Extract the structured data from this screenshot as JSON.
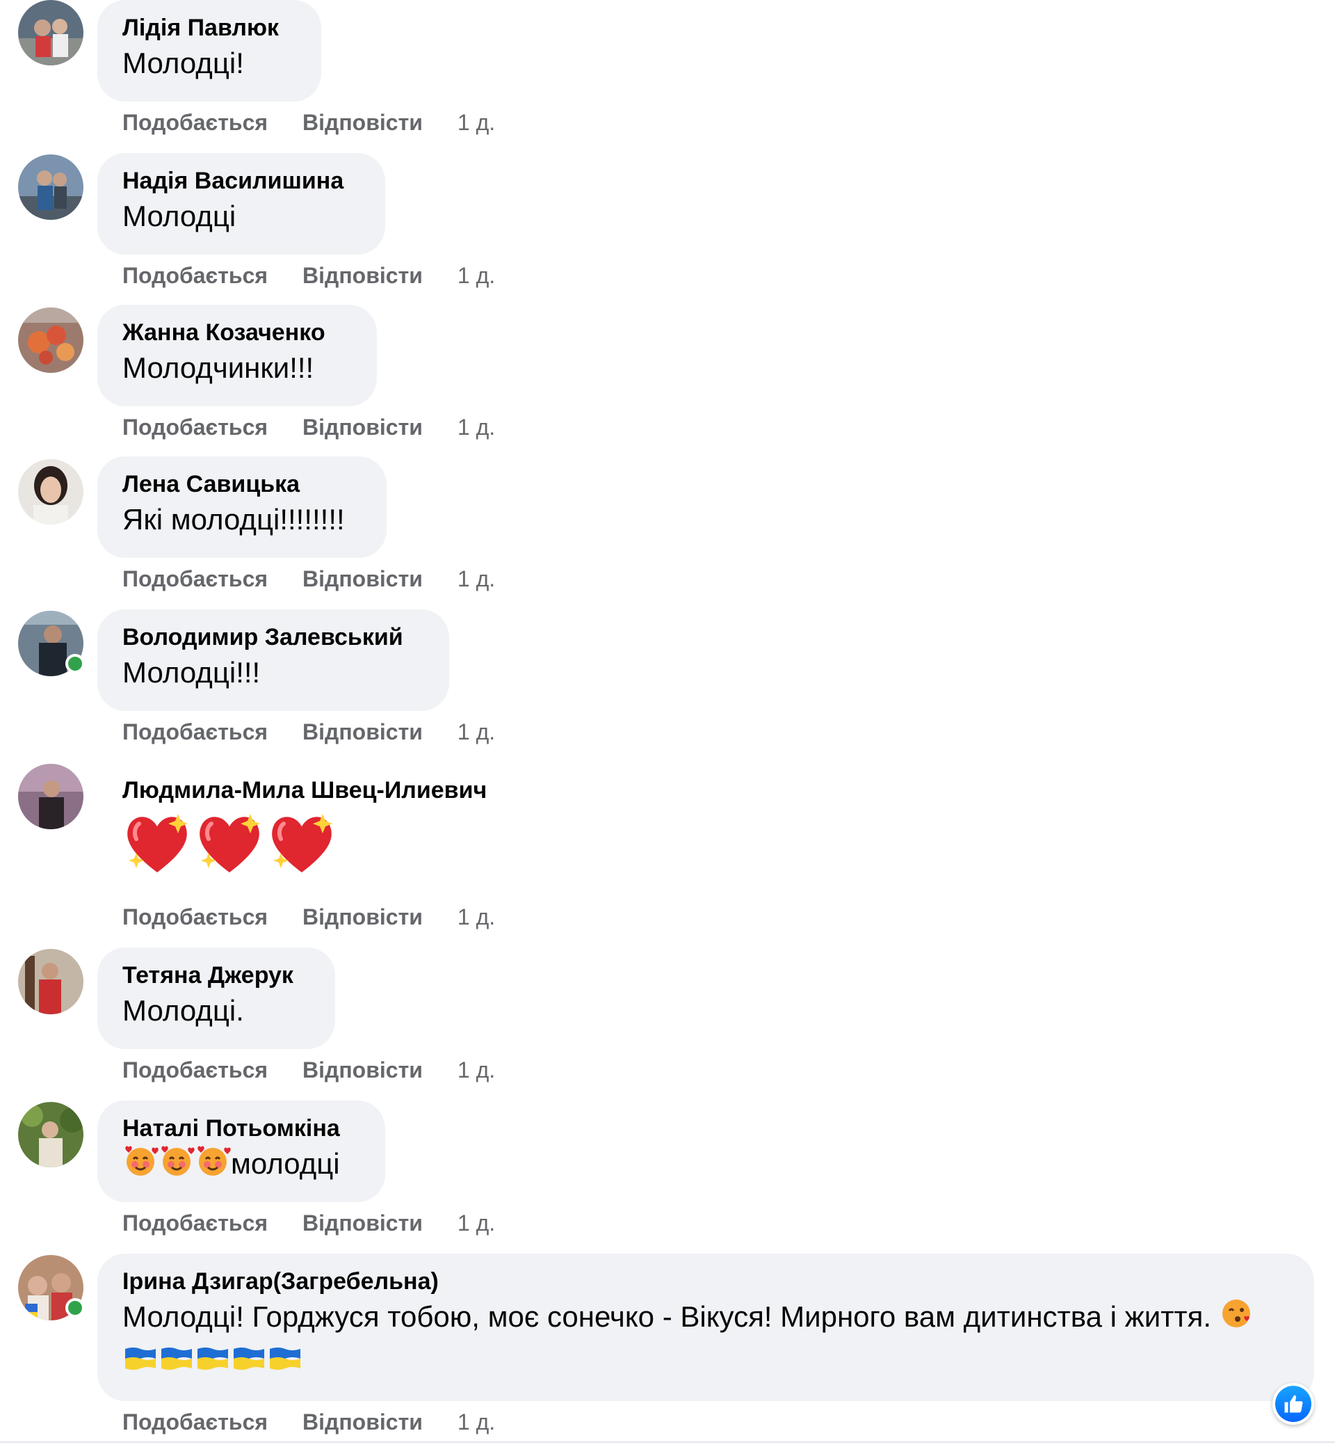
{
  "actions": {
    "like": "Подобається",
    "reply": "Відповісти",
    "time": "1 д."
  },
  "comments": [
    {
      "author": "Лідія Павлюк",
      "text": "Молодці!"
    },
    {
      "author": "Надія Василишина",
      "text": "Молодці"
    },
    {
      "author": "Жанна Козаченко",
      "text": "Молодчинки!!!"
    },
    {
      "author": "Лена Савицька",
      "text": "Які молодці!!!!!!!!"
    },
    {
      "author": "Володимир Залевський",
      "text": "Молодці!!!"
    },
    {
      "author": "Людмила-Мила Швец-Илиевич",
      "text": ""
    },
    {
      "author": "Тетяна Джерук",
      "text": "Молодці."
    },
    {
      "author": "Наталі Потьомкіна",
      "text": "молодці"
    },
    {
      "author": "Ірина Дзигар(Загребельна)",
      "text": "Молодці! Горджуся тобою, моє сонечко - Вікуся! Мирного вам дитинства і життя."
    }
  ],
  "icons": {
    "sparkling_heart": "sparkling-heart-emoji",
    "smiling_hearts": "smiling-face-with-hearts-emoji",
    "kiss": "face-blowing-kiss-emoji",
    "flag": "ukraine-flag-emoji",
    "like_badge": "thumbs-up-icon"
  },
  "colors": {
    "bubble": "#f0f2f5",
    "action_text": "#65676b",
    "online": "#31a24c",
    "like_blue": "#0866ff"
  }
}
